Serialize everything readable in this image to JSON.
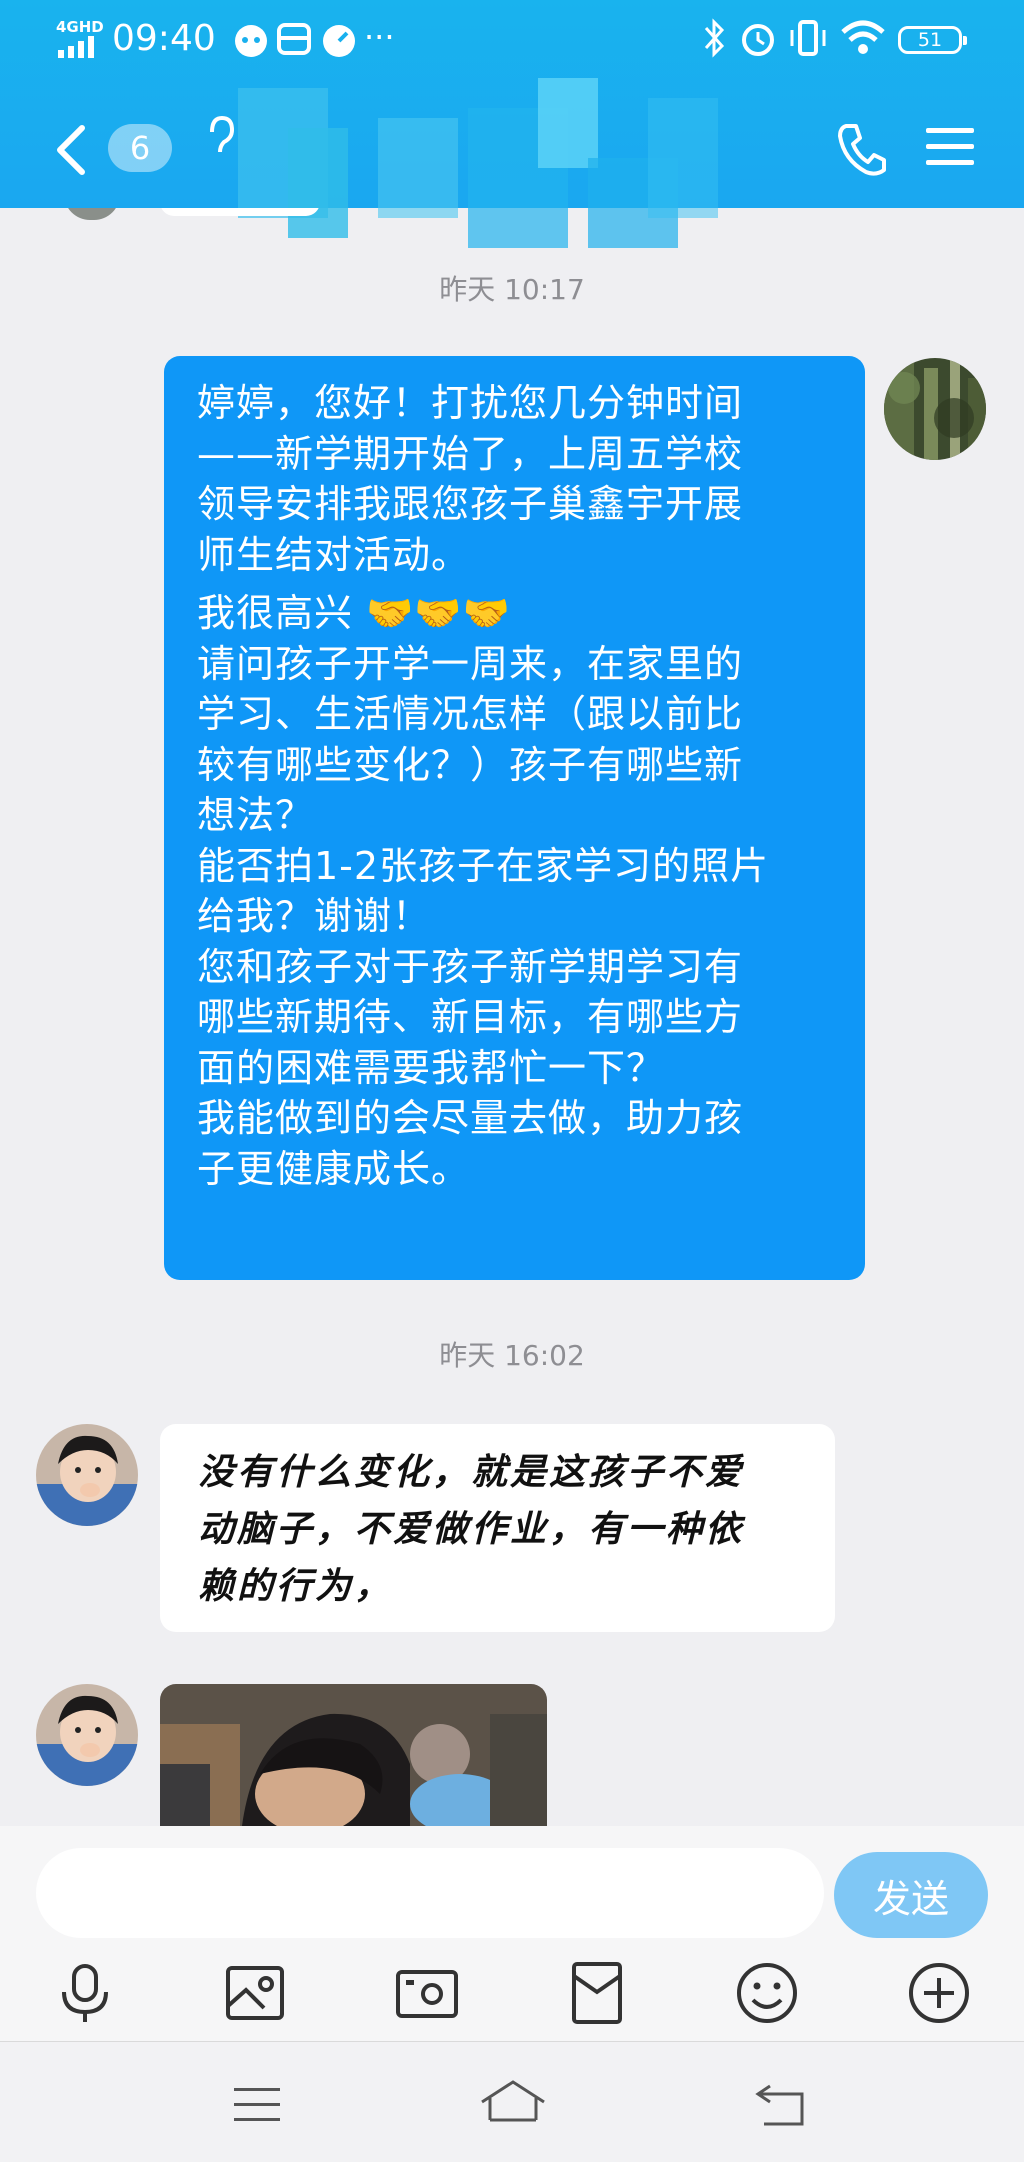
{
  "statusbar": {
    "network": "4GHD",
    "time": "09:40",
    "more": "···",
    "battery": "51"
  },
  "header": {
    "unread_count": "6",
    "icons": [
      "back-chevron-icon",
      "ear-icon",
      "phone-icon",
      "menu-icon"
    ]
  },
  "messages": [
    {
      "type": "timestamp",
      "text": "昨天 10:17"
    },
    {
      "type": "outgoing",
      "paragraphs": [
        [
          "婷婷，您好！打扰您几分钟时间",
          "——新学期开始了，上周五学校",
          "领导安排我跟您孩子巢鑫宇开展",
          "师生结对活动。"
        ],
        [
          "我很高兴 🤝🤝🤝",
          "请问孩子开学一周来，在家里的",
          "学习、生活情况怎样（跟以前比",
          "较有哪些变化？）孩子有哪些新",
          "想法？",
          "能否拍1-2张孩子在家学习的照片",
          "给我？谢谢！",
          "您和孩子对于孩子新学期学习有",
          "哪些新期待、新目标，有哪些方",
          "面的困难需要我帮忙一下？",
          "我能做到的会尽量去做，助力孩",
          "子更健康成长。"
        ]
      ]
    },
    {
      "type": "timestamp",
      "text": "昨天 16:02"
    },
    {
      "type": "incoming",
      "lines": [
        "没有什么变化，就是这孩子不爱",
        "动脑子，不爱做作业，有一种依",
        "赖的行为，"
      ]
    },
    {
      "type": "incoming-image"
    }
  ],
  "input": {
    "placeholder": "",
    "value": "",
    "send_label": "发送"
  },
  "toolbar": [
    "microphone-icon",
    "image-icon",
    "camera-icon",
    "red-packet-icon",
    "emoji-icon",
    "plus-icon"
  ],
  "colors": {
    "header": "#1aabef",
    "outgoing_bubble": "#0f97f7",
    "send_button": "#7fc7f5",
    "background": "#efeff2"
  }
}
